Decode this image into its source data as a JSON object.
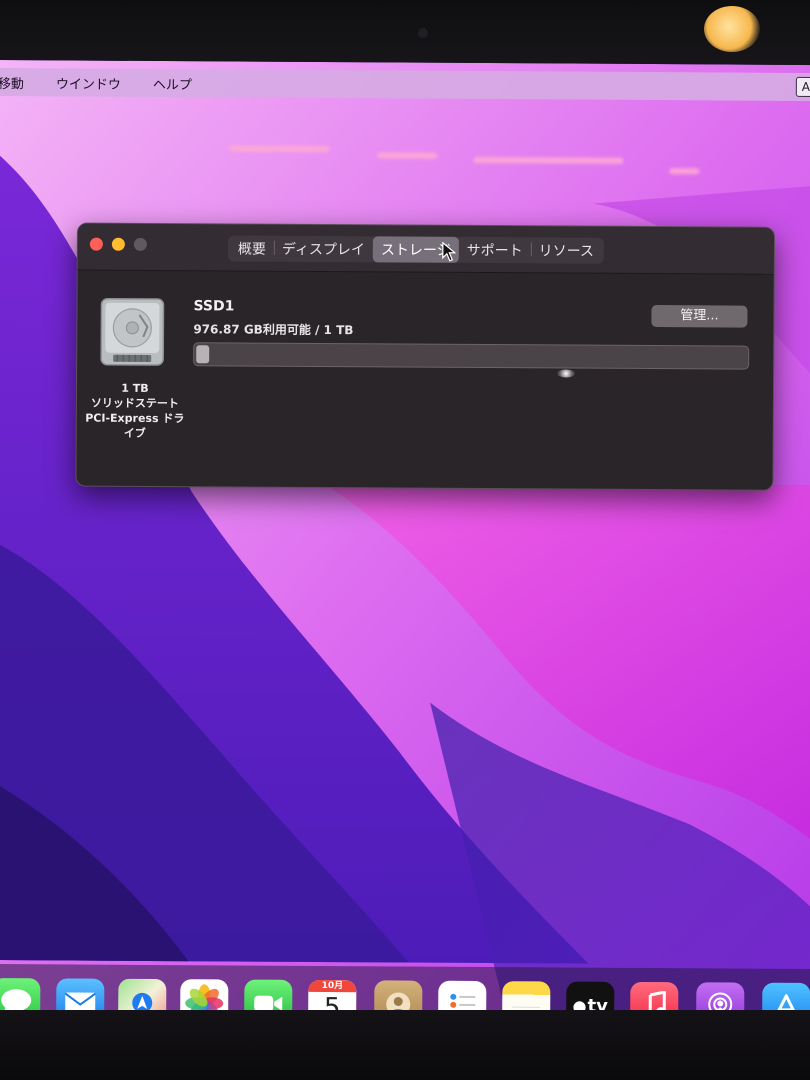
{
  "menubar": {
    "items": [
      "移動",
      "ウインドウ",
      "ヘルプ"
    ],
    "input_indicator": "A"
  },
  "window": {
    "tabs": [
      "概要",
      "ディスプレイ",
      "ストレージ",
      "サポート",
      "リソース"
    ],
    "active_tab": "ストレージ",
    "drive_caption": [
      "1 TB",
      "ソリッドステート",
      "PCI-Express ドラ",
      "イブ"
    ],
    "disk_name": "SSD1",
    "availability": "976.87 GB利用可能 / 1 TB",
    "manage_label": "管理...",
    "used_fraction": 0.023
  },
  "dock": {
    "icons": [
      "messages-icon",
      "mail-icon",
      "maps-icon",
      "photos-icon",
      "facetime-icon",
      "calendar-icon",
      "contacts-icon",
      "reminders-icon",
      "notes-icon",
      "apple-tv-icon",
      "music-icon",
      "podcasts-icon",
      "app-store-icon"
    ],
    "calendar_month": "10月",
    "calendar_day": "5",
    "tv_label": "tv"
  },
  "colors": {
    "close": "#fe5f57",
    "minimize": "#febc2e",
    "window_bg": "#2a2529",
    "accent_tab": "#77707a"
  }
}
